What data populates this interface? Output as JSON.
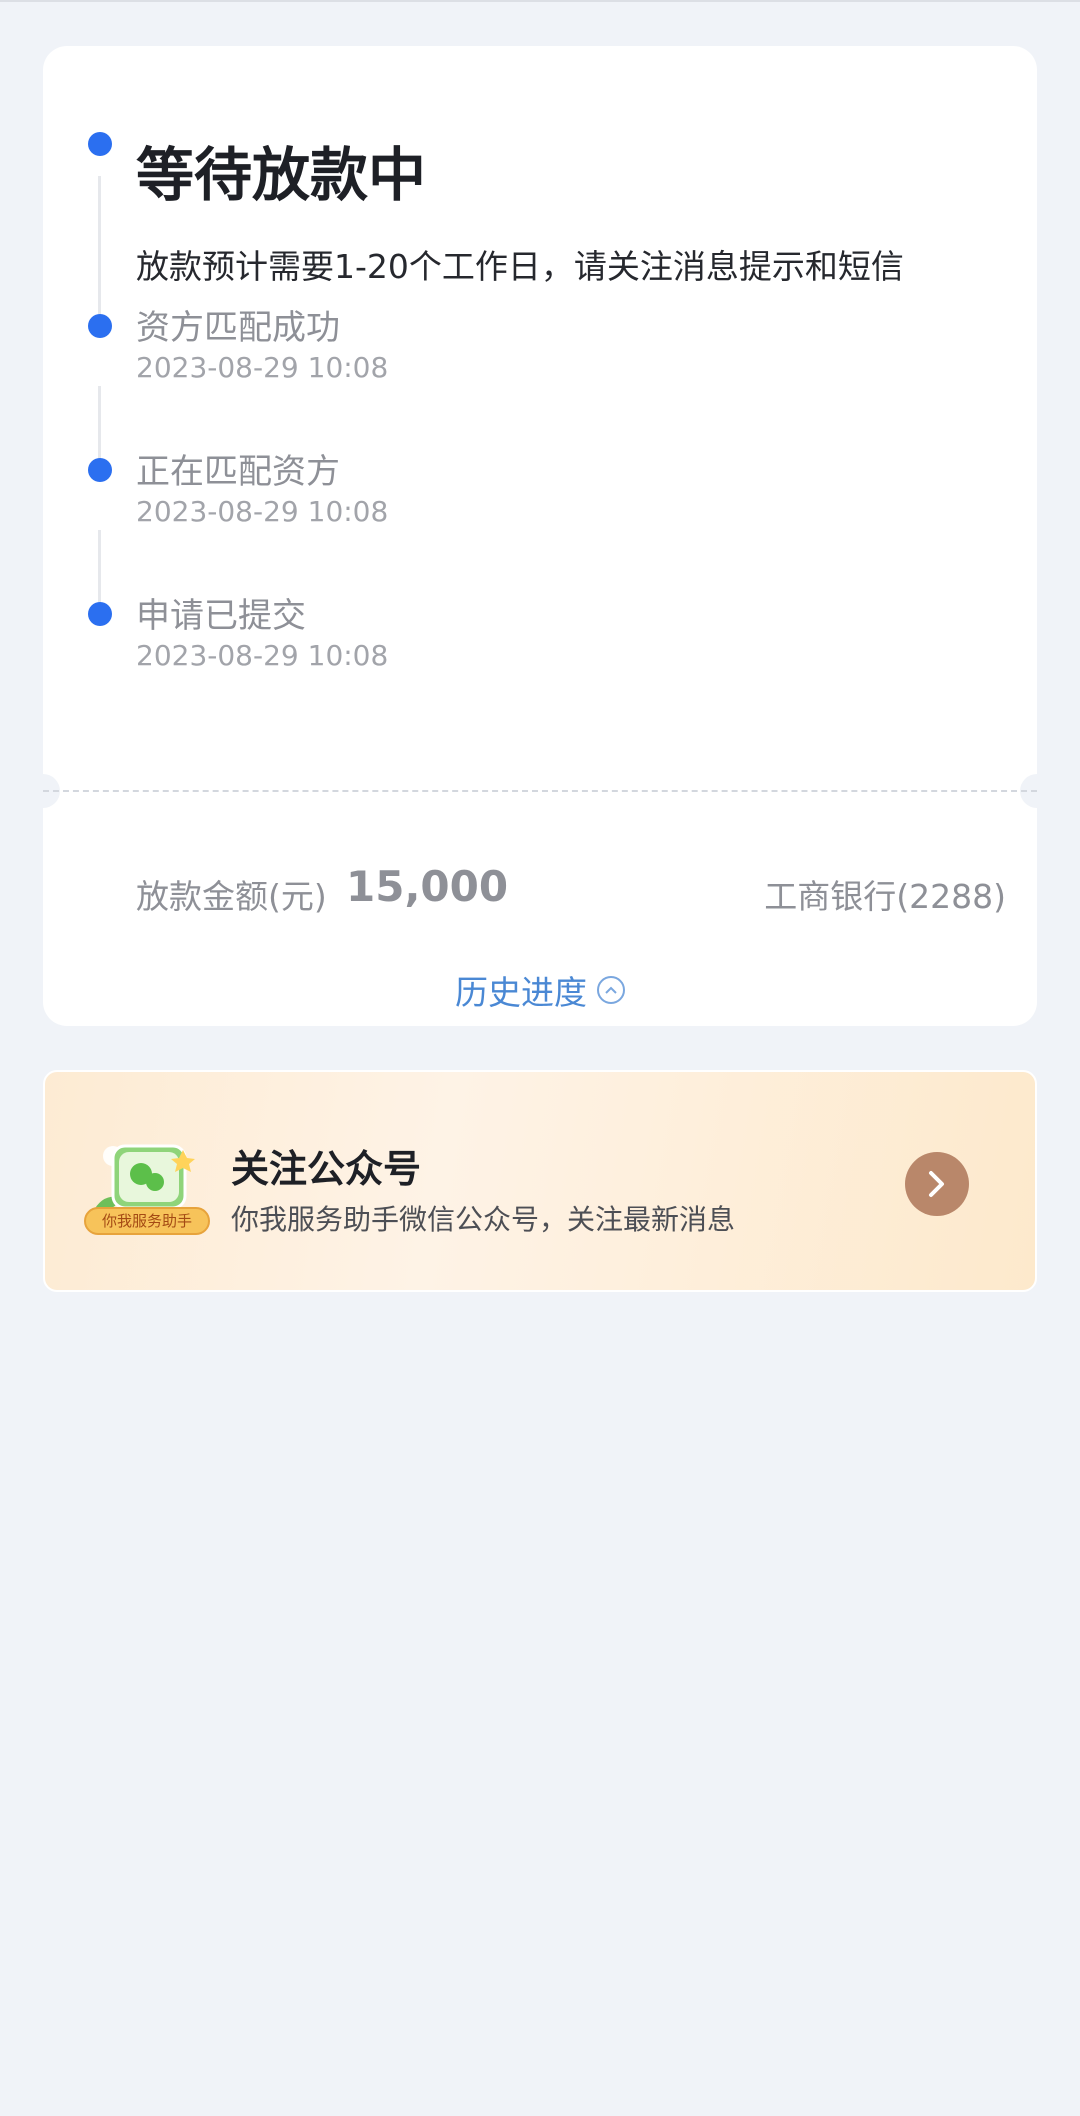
{
  "status_card": {
    "current": {
      "title": "等待放款中",
      "description": "放款预计需要1-20个工作日，请关注消息提示和短信"
    },
    "steps": [
      {
        "title": "资方匹配成功",
        "time": "2023-08-29 10:08"
      },
      {
        "title": "正在匹配资方",
        "time": "2023-08-29 10:08"
      },
      {
        "title": "申请已提交",
        "time": "2023-08-29 10:08"
      }
    ],
    "amount_label": "放款金额(元)",
    "amount_value": "15,000",
    "bank": "工商银行(2288)",
    "history_label": "历史进度"
  },
  "banner": {
    "title": "关注公众号",
    "subtitle": "你我服务助手微信公众号，关注最新消息",
    "badge_text": "你我服务助手",
    "icon": "wechat-icon"
  },
  "colors": {
    "accent": "#2b6ff0",
    "link": "#4a88d4",
    "banner_arrow": "#b9876a"
  }
}
